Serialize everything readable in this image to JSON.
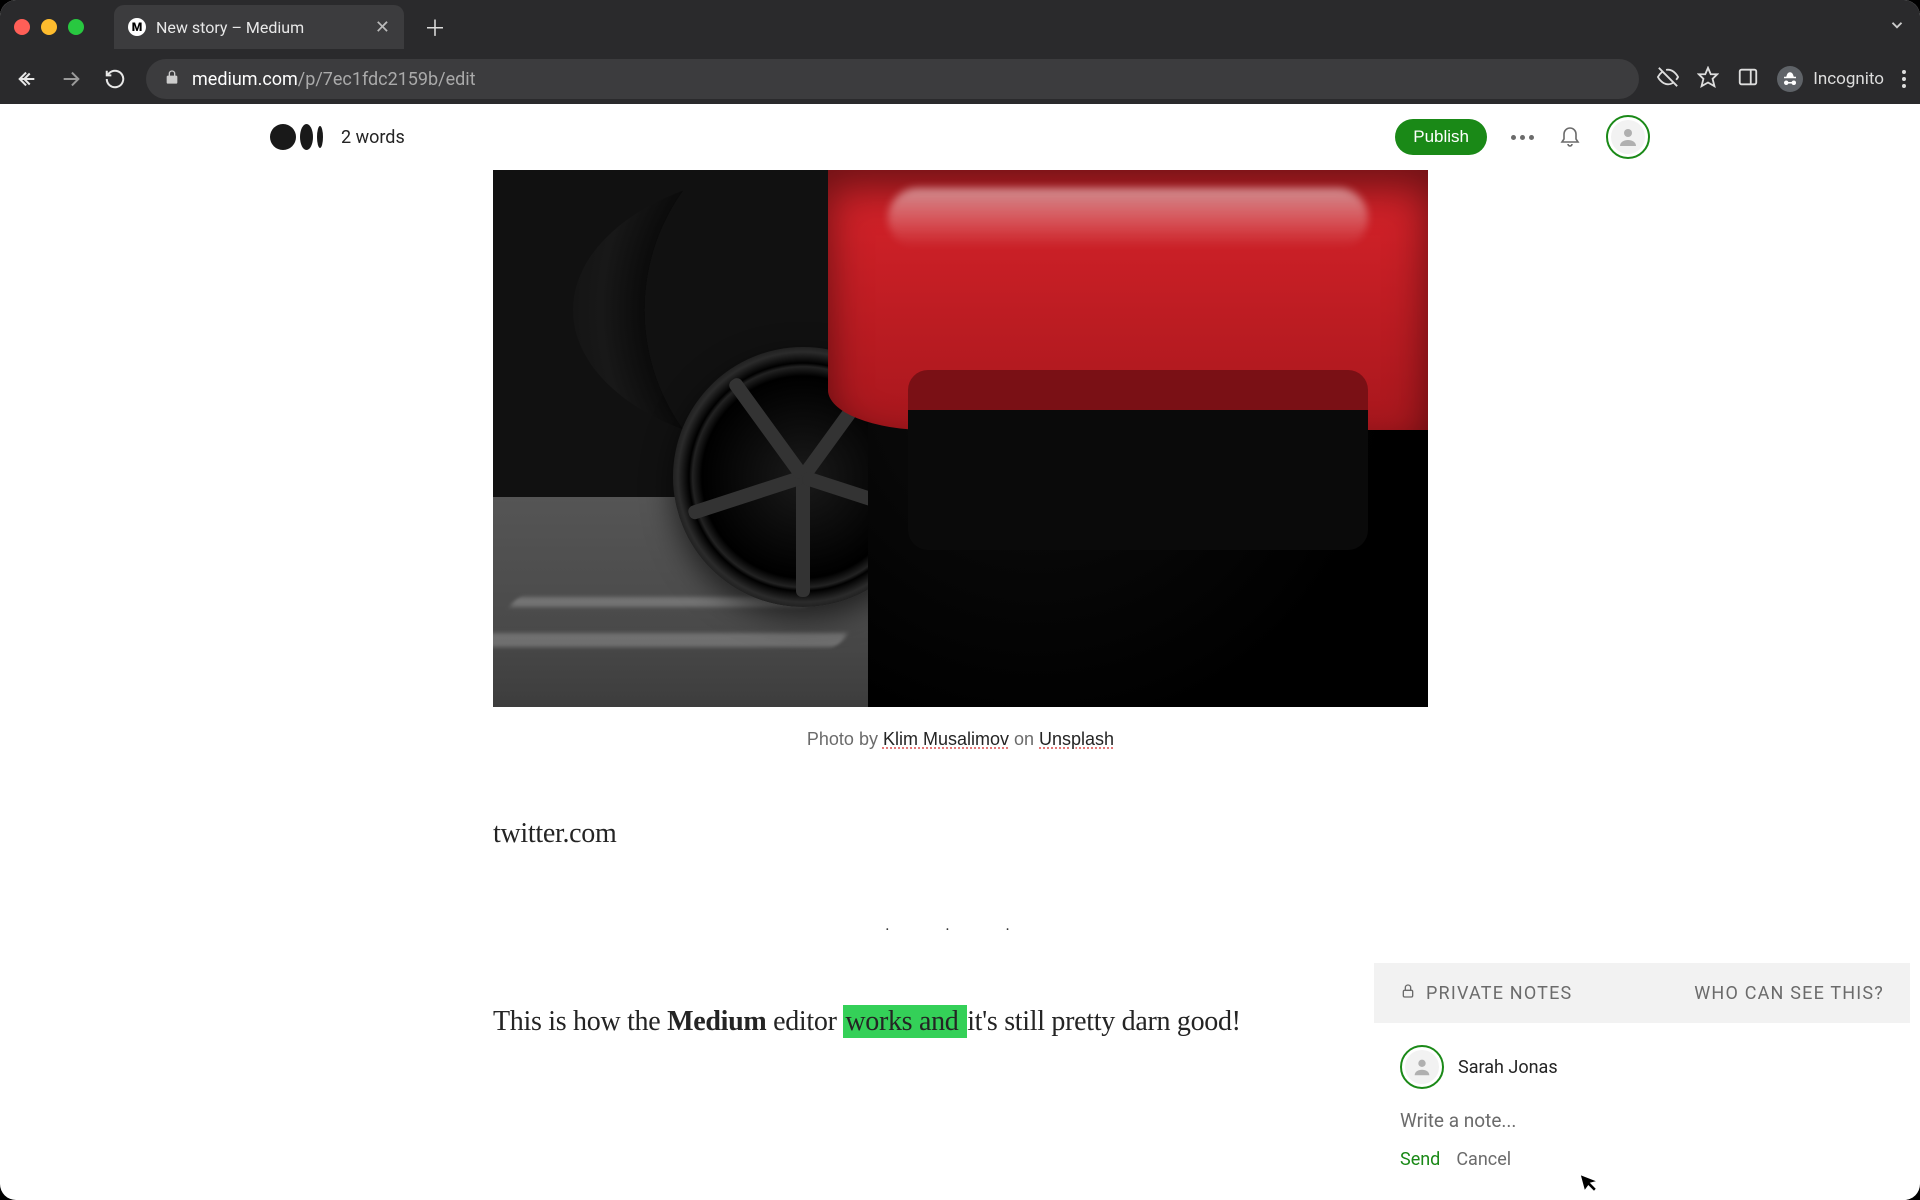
{
  "browser": {
    "tab_title": "New story – Medium",
    "url_host": "medium.com",
    "url_path": "/p/7ec1fdc2159b/edit",
    "incognito_label": "Incognito"
  },
  "header": {
    "word_count": "2 words",
    "publish_label": "Publish"
  },
  "caption": {
    "prefix": "Photo by ",
    "author": "Klim Musalimov",
    "middle": " on ",
    "source": "Unsplash"
  },
  "editor": {
    "twitter_text": "twitter.com",
    "separator": "· · ·",
    "body_p1_a": "This is how the ",
    "body_p1_bold": "Medium",
    "body_p1_b": " editor ",
    "body_p1_hl": "works and ",
    "body_p1_c": "it's still pretty darn good!"
  },
  "notes": {
    "title": "PRIVATE NOTES",
    "who": "WHO CAN SEE THIS?",
    "user": "Sarah Jonas",
    "placeholder": "Write a note...",
    "send": "Send",
    "cancel": "Cancel"
  }
}
